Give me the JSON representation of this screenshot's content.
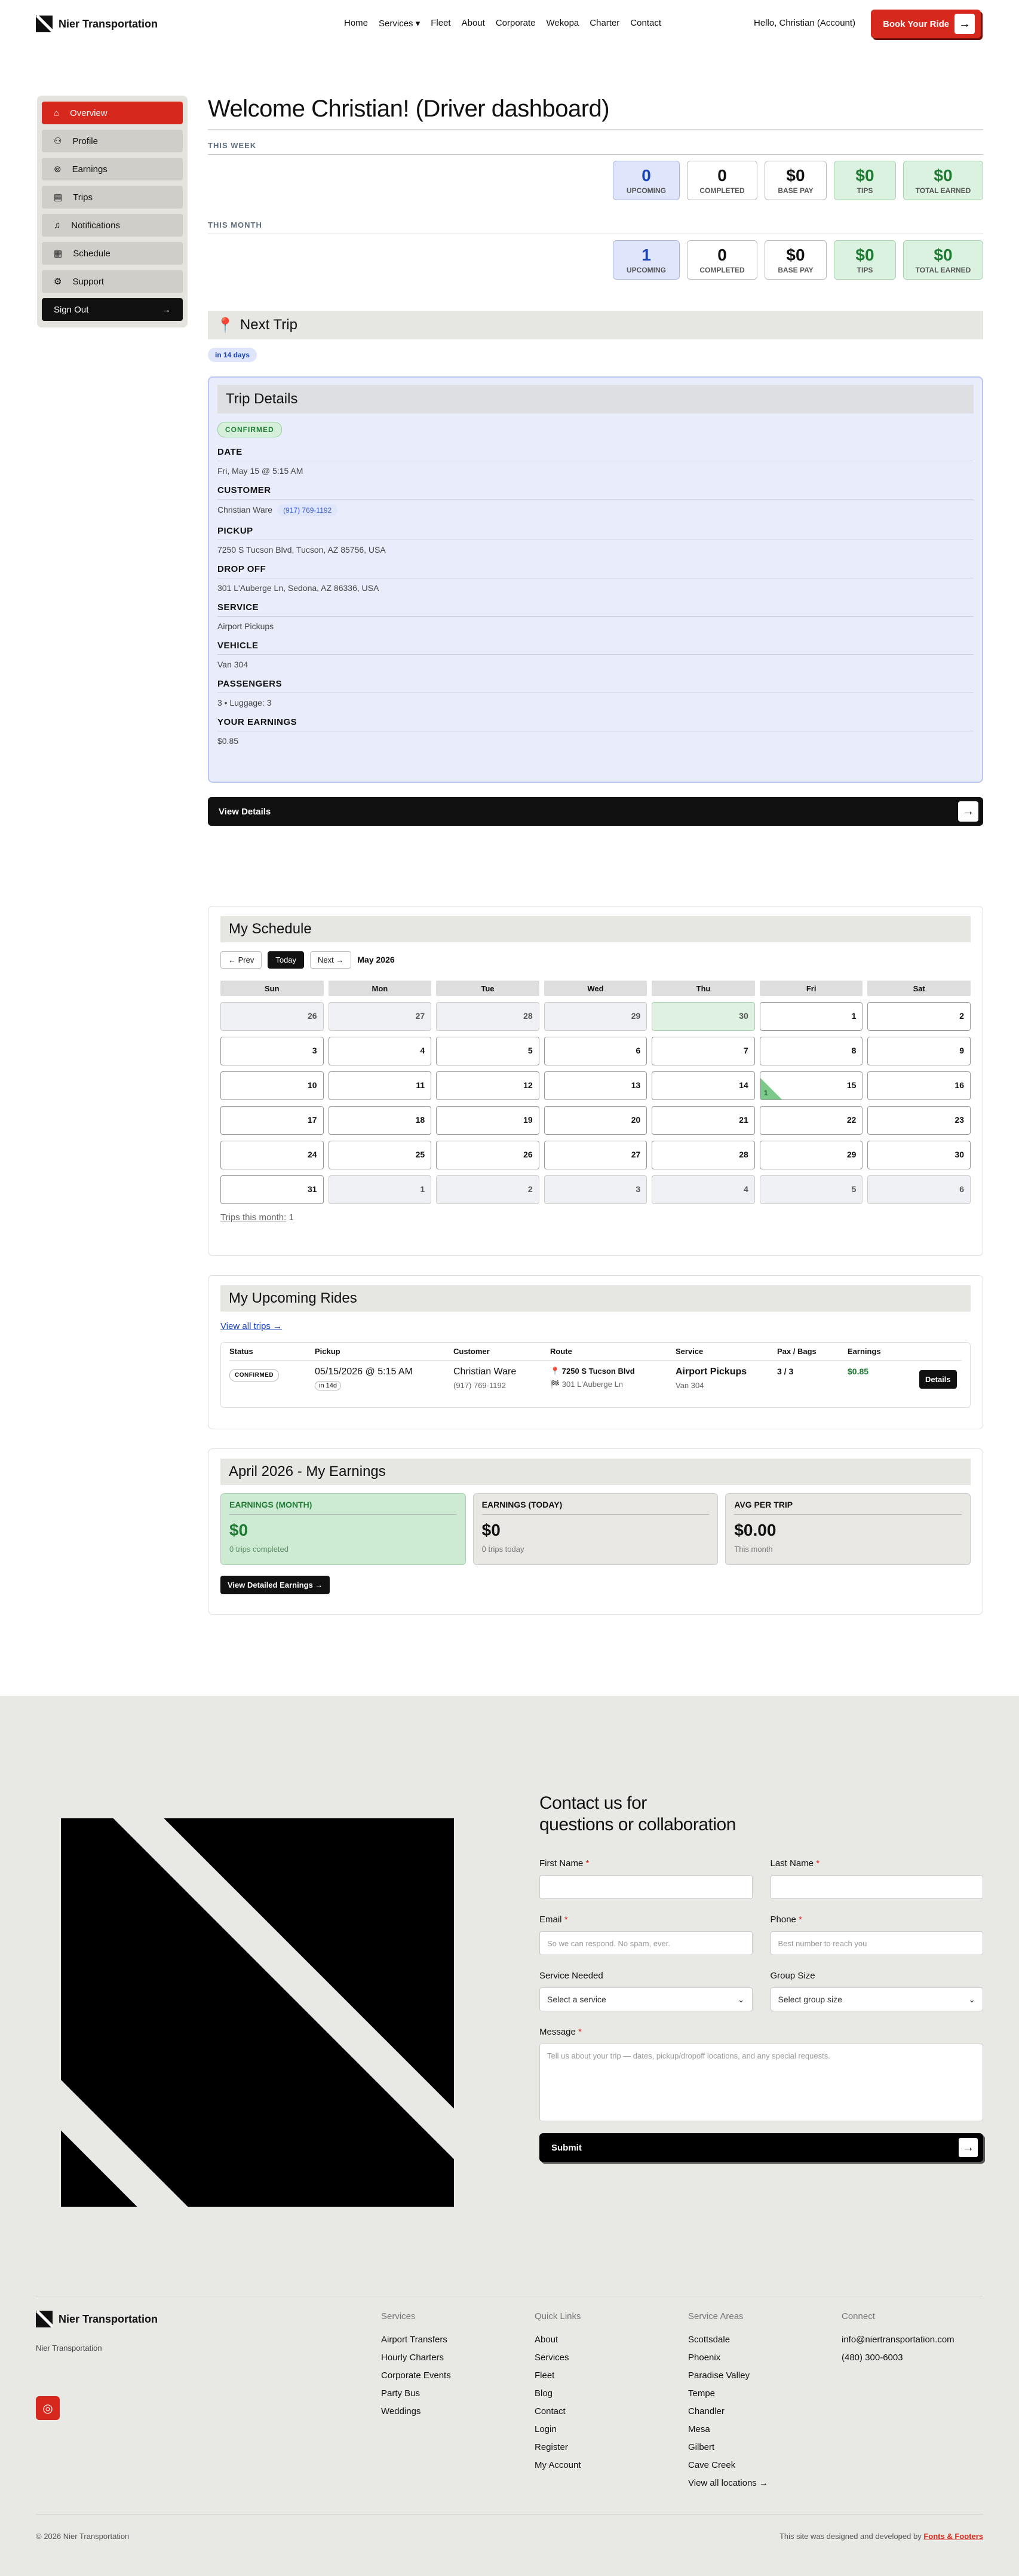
{
  "header": {
    "brand": "Nier Transportation",
    "nav": [
      "Home",
      "Services",
      "Fleet",
      "About",
      "Corporate",
      "Wekopa",
      "Charter",
      "Contact"
    ],
    "services_caret": "▾",
    "greeting": "Hello, Christian (Account)",
    "book": "Book Your Ride"
  },
  "sidebar": {
    "items": [
      {
        "label": "Overview",
        "icon": "house-icon"
      },
      {
        "label": "Profile",
        "icon": "user-icon"
      },
      {
        "label": "Earnings",
        "icon": "dollar-icon"
      },
      {
        "label": "Trips",
        "icon": "clipboard-icon"
      },
      {
        "label": "Notifications",
        "icon": "bell-icon"
      },
      {
        "label": "Schedule",
        "icon": "calendar-icon"
      },
      {
        "label": "Support",
        "icon": "gear-icon"
      }
    ],
    "signout": "Sign Out"
  },
  "main": {
    "title": "Welcome Christian! (Driver dashboard)",
    "this_week": {
      "label": "THIS WEEK",
      "stats": [
        {
          "v": "0",
          "l": "UPCOMING"
        },
        {
          "v": "0",
          "l": "COMPLETED"
        },
        {
          "v": "$0",
          "l": "BASE PAY"
        },
        {
          "v": "$0",
          "l": "TIPS"
        },
        {
          "v": "$0",
          "l": "TOTAL EARNED"
        }
      ]
    },
    "this_month": {
      "label": "THIS MONTH",
      "stats": [
        {
          "v": "1",
          "l": "UPCOMING"
        },
        {
          "v": "0",
          "l": "COMPLETED"
        },
        {
          "v": "$0",
          "l": "BASE PAY"
        },
        {
          "v": "$0",
          "l": "TIPS"
        },
        {
          "v": "$0",
          "l": "TOTAL EARNED"
        }
      ]
    },
    "next_trip": {
      "title": "Next Trip",
      "days": "in 14 days"
    },
    "trip": {
      "title": "Trip Details",
      "status": "CONFIRMED",
      "date_k": "DATE",
      "date_v": "Fri, May 15 @ 5:15 AM",
      "customer_k": "CUSTOMER",
      "customer_v": "Christian Ware",
      "phone": "(917) 769-1192",
      "pickup_k": "PICKUP",
      "pickup_v": "7250 S Tucson Blvd, Tucson, AZ 85756, USA",
      "dropoff_k": "DROP OFF",
      "dropoff_v": "301 L'Auberge Ln, Sedona, AZ 86336, USA",
      "service_k": "SERVICE",
      "service_v": "Airport Pickups",
      "vehicle_k": "VEHICLE",
      "vehicle_v": "Van 304",
      "passengers_k": "PASSENGERS",
      "passengers_v": "3 • Luggage: 3",
      "earnings_k": "YOUR EARNINGS",
      "earnings_v": "$0.85"
    },
    "view_details": "View Details"
  },
  "schedule": {
    "title": "My Schedule",
    "prev": "← Prev",
    "today": "Today",
    "next": "Next →",
    "month": "May 2026",
    "dow": [
      "Sun",
      "Mon",
      "Tue",
      "Wed",
      "Thu",
      "Fri",
      "Sat"
    ],
    "days": [
      [
        "26",
        "27",
        "28",
        "29",
        "30",
        "1",
        "2"
      ],
      [
        "3",
        "4",
        "5",
        "6",
        "7",
        "8",
        "9"
      ],
      [
        "10",
        "11",
        "12",
        "13",
        "14",
        "15",
        "16"
      ],
      [
        "17",
        "18",
        "19",
        "20",
        "21",
        "22",
        "23"
      ],
      [
        "24",
        "25",
        "26",
        "27",
        "28",
        "29",
        "30"
      ],
      [
        "31",
        "1",
        "2",
        "3",
        "4",
        "5",
        "6"
      ]
    ],
    "trip_count_on_15": "1",
    "trips_label": "Trips this month:",
    "trips_value": "1"
  },
  "upcoming": {
    "title": "My Upcoming Rides",
    "view_all": "View all trips →",
    "headers": [
      "Status",
      "Pickup",
      "Customer",
      "Route",
      "Service",
      "Pax / Bags",
      "Earnings"
    ],
    "row": {
      "status": "CONFIRMED",
      "pickup": "05/15/2026 @ 5:15 AM",
      "in": "in 14d",
      "customer": "Christian Ware",
      "phone": "(917) 769-1192",
      "route_from": "📍 7250 S Tucson Blvd",
      "route_to": "🏁 301 L'Auberge Ln",
      "service": "Airport Pickups",
      "vehicle": "Van 304",
      "pax": "3 / 3",
      "earnings": "$0.85",
      "details": "Details"
    }
  },
  "earnings": {
    "title": "April 2026 - My Earnings",
    "cards": [
      {
        "t": "EARNINGS (MONTH)",
        "v": "$0",
        "s": "0 trips completed"
      },
      {
        "t": "EARNINGS (TODAY)",
        "v": "$0",
        "s": "0 trips today"
      },
      {
        "t": "AVG PER TRIP",
        "v": "$0.00",
        "s": "This month"
      }
    ],
    "button": "View Detailed Earnings →"
  },
  "contact": {
    "heading1": "Contact us for",
    "heading2": "questions or collaboration",
    "first": "First Name",
    "last": "Last Name",
    "email": "Email",
    "email_ph": "So we can respond. No spam, ever.",
    "phone": "Phone",
    "phone_ph": "Best number to reach you",
    "service": "Service Needed",
    "service_sel": "Select a service",
    "group": "Group Size",
    "group_sel": "Select group size",
    "message": "Message",
    "message_ph": "Tell us about your trip — dates, pickup/dropoff locations, and any special requests.",
    "submit": "Submit",
    "req": "*"
  },
  "footer": {
    "brand": "Nier Transportation",
    "brand_sub": "Nier Transportation",
    "services": {
      "h": "Services",
      "items": [
        "Airport Transfers",
        "Hourly Charters",
        "Corporate Events",
        "Party Bus",
        "Weddings"
      ]
    },
    "links": {
      "h": "Quick Links",
      "items": [
        "About",
        "Services",
        "Fleet",
        "Blog",
        "Contact",
        "Login",
        "Register",
        "My Account"
      ]
    },
    "areas": {
      "h": "Service Areas",
      "items": [
        "Scottsdale",
        "Phoenix",
        "Paradise Valley",
        "Tempe",
        "Chandler",
        "Mesa",
        "Gilbert",
        "Cave Creek",
        "View all locations →"
      ]
    },
    "connect": {
      "h": "Connect",
      "items": [
        "info@niertransportation.com",
        "(480) 300-6003"
      ]
    },
    "copyright": "© 2026 Nier Transportation",
    "credit": "This site was designed and developed by",
    "credit_link": "Fonts & Footers"
  },
  "colors": {
    "accent": "#d7281e",
    "dark": "#111111",
    "blue": "#1a43b5",
    "green": "#1f7a33"
  }
}
